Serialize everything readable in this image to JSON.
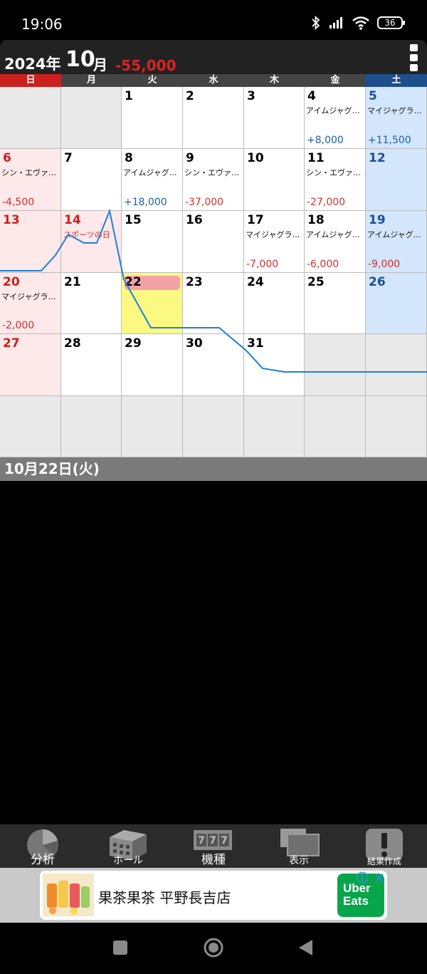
{
  "status_bar": {
    "time": "19:06",
    "battery": "36",
    "icons": [
      "bluetooth-icon",
      "signal-icon",
      "wifi-icon",
      "battery-icon"
    ]
  },
  "header": {
    "year": "2024年",
    "month": "10",
    "month_suffix": "月",
    "total": "-55,000"
  },
  "weekdays": [
    "日",
    "月",
    "火",
    "水",
    "木",
    "金",
    "土"
  ],
  "colors": {
    "sunday": "#cc1f1f",
    "weekday": "#444444",
    "saturday": "#1d4f8f",
    "positive": "#1f5fa8",
    "negative": "#d03030",
    "today": "#fbf982",
    "today_badge": "#f3a3a8",
    "trend_line": "#1f7fdb"
  },
  "calendar": {
    "today": 22,
    "weeks": [
      [
        {
          "day": ""
        },
        {
          "day": ""
        },
        {
          "day": "1"
        },
        {
          "day": "2"
        },
        {
          "day": "3"
        },
        {
          "day": "4",
          "machine": "アイムジャグ…",
          "amount": "+8,000"
        },
        {
          "day": "5",
          "machine": "マイジャグラ…",
          "amount": "+11,500"
        }
      ],
      [
        {
          "day": "6",
          "machine": "シン・エヴァ…",
          "amount": "-4,500"
        },
        {
          "day": "7"
        },
        {
          "day": "8",
          "machine": "アイムジャグ…",
          "amount": "+18,000"
        },
        {
          "day": "9",
          "machine": "シン・エヴァ…",
          "amount": "-37,000"
        },
        {
          "day": "10"
        },
        {
          "day": "11",
          "machine": "シン・エヴァ…",
          "amount": "-27,000"
        },
        {
          "day": "12"
        }
      ],
      [
        {
          "day": "13"
        },
        {
          "day": "14",
          "holiday": "スポーツの日"
        },
        {
          "day": "15"
        },
        {
          "day": "16"
        },
        {
          "day": "17",
          "machine": "マイジャグラ…",
          "amount": "-7,000"
        },
        {
          "day": "18",
          "machine": "アイムジャグ…",
          "amount": "-6,000"
        },
        {
          "day": "19",
          "machine": "アイムジャグ…",
          "amount": "-9,000"
        }
      ],
      [
        {
          "day": "20",
          "machine": "マイジャグラ…",
          "amount": "-2,000"
        },
        {
          "day": "21"
        },
        {
          "day": "22"
        },
        {
          "day": "23"
        },
        {
          "day": "24"
        },
        {
          "day": "25"
        },
        {
          "day": "26"
        }
      ],
      [
        {
          "day": "27"
        },
        {
          "day": "28"
        },
        {
          "day": "29"
        },
        {
          "day": "30"
        },
        {
          "day": "31"
        },
        {
          "day": ""
        },
        {
          "day": ""
        }
      ],
      [
        {
          "day": ""
        },
        {
          "day": ""
        },
        {
          "day": ""
        },
        {
          "day": ""
        },
        {
          "day": ""
        },
        {
          "day": ""
        },
        {
          "day": ""
        }
      ]
    ]
  },
  "selected_date": "10月22日(火)",
  "toolbar": [
    {
      "label": "分析",
      "icon": "pie-chart-icon"
    },
    {
      "label": "ホール",
      "icon": "building-icon"
    },
    {
      "label": "機種",
      "icon": "slot-machine-icon"
    },
    {
      "label": "表示",
      "icon": "display-icon"
    },
    {
      "label": "結果作成",
      "icon": "exclamation-icon"
    }
  ],
  "ad": {
    "text": "果茶果茶 平野長吉店",
    "brand_line1": "Uber",
    "brand_line2": "Eats"
  },
  "nav": [
    "recents-button",
    "home-button",
    "back-button"
  ]
}
